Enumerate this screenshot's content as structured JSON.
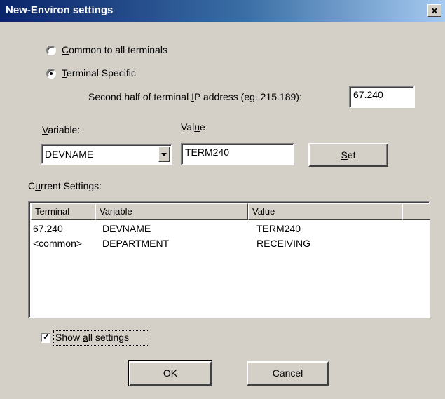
{
  "window": {
    "title": "New-Environ settings",
    "close_glyph": "✕"
  },
  "scope": {
    "options": [
      {
        "label_u": "C",
        "label_rest": "ommon to all terminals",
        "selected": false
      },
      {
        "label_u": "T",
        "label_rest": "erminal Specific",
        "selected": true
      }
    ]
  },
  "ip": {
    "label_pre": "Second half of terminal ",
    "label_u": "I",
    "label_post": "P address (eg. 215.189):",
    "value": "67.240"
  },
  "variable": {
    "label_u": "V",
    "label_rest": "ariable:",
    "value": "DEVNAME"
  },
  "value_field": {
    "label_pre": "Val",
    "label_u": "u",
    "label_post": "e",
    "value": "TERM240"
  },
  "set_button": {
    "label_u": "S",
    "label_rest": "et"
  },
  "current_settings": {
    "label_pre": "C",
    "label_u": "u",
    "label_post": "rrent Settings:",
    "columns": [
      "Terminal",
      "Variable",
      "Value"
    ],
    "rows": [
      {
        "terminal": "67.240",
        "variable": "DEVNAME",
        "value": "TERM240"
      },
      {
        "terminal": "<common>",
        "variable": "DEPARTMENT",
        "value": "RECEIVING"
      }
    ]
  },
  "show_all": {
    "label_pre": "Show ",
    "label_u": "a",
    "label_post": "ll settings",
    "checked": true,
    "check_glyph": "✓"
  },
  "ok_button": "OK",
  "cancel_button": "Cancel"
}
